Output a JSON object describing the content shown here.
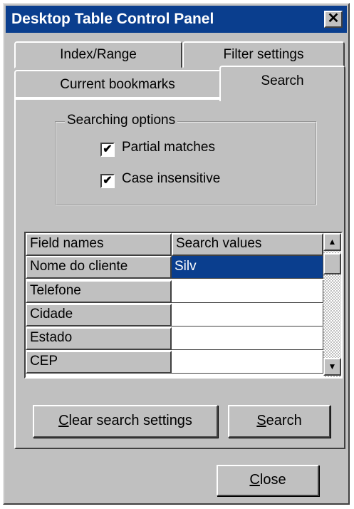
{
  "window": {
    "title": "Desktop Table Control Panel",
    "close_glyph": "✕"
  },
  "tabs": [
    {
      "label": "Index/Range"
    },
    {
      "label": "Filter settings"
    },
    {
      "label": "Current bookmarks"
    },
    {
      "label": "Search",
      "active": true
    }
  ],
  "search_options": {
    "group_title": "Searching options",
    "partial_matches": {
      "label": "Partial matches",
      "checked": true,
      "mark": "✔"
    },
    "case_insensitive": {
      "label": "Case insensitive",
      "checked": true,
      "mark": "✔"
    }
  },
  "grid": {
    "headers": [
      "Field names",
      "Search values"
    ],
    "rows": [
      {
        "field": "Nome do cliente",
        "value": "Silv",
        "selected": true
      },
      {
        "field": "Telefone",
        "value": ""
      },
      {
        "field": "Cidade",
        "value": ""
      },
      {
        "field": "Estado",
        "value": ""
      },
      {
        "field": "CEP",
        "value": ""
      }
    ],
    "scroll_up": "▲",
    "scroll_down": "▼"
  },
  "buttons": {
    "clear_first": "C",
    "clear_rest": "lear search settings",
    "search_first": "S",
    "search_rest": "earch",
    "close_first": "C",
    "close_rest": "lose"
  }
}
